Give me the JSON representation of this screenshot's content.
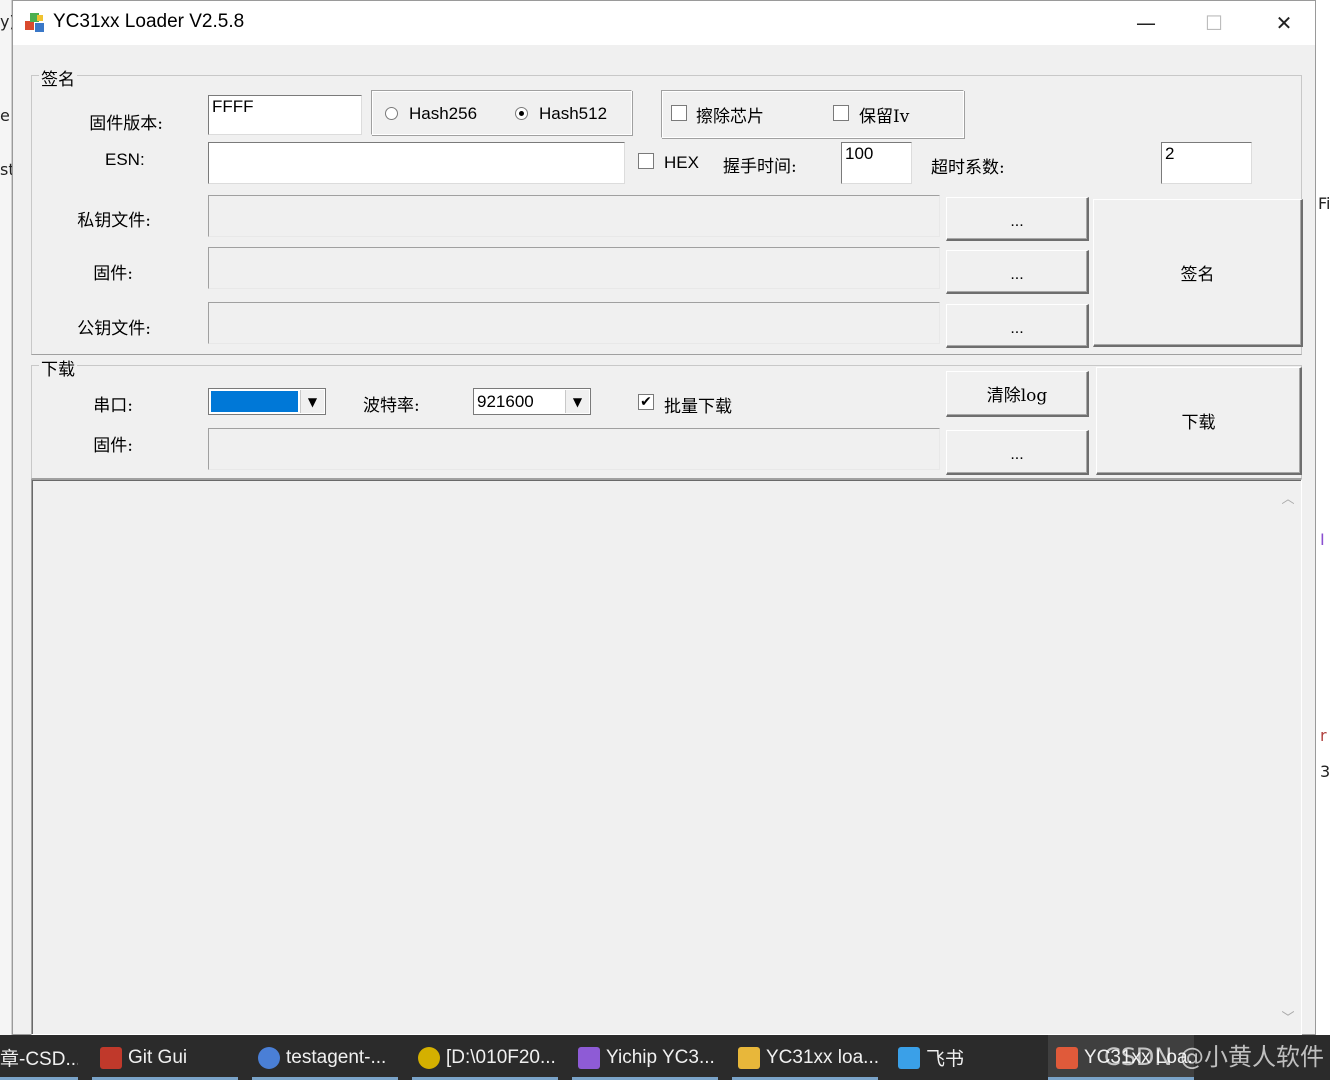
{
  "background": {
    "left_fragments": [
      "y)",
      "e",
      "st"
    ],
    "right_fragments": [
      "Fi",
      "I",
      "r",
      "3"
    ]
  },
  "window": {
    "title": "YC31xx Loader V2.5.8",
    "icon": "app-cubes-icon",
    "controls": {
      "minimize": "—",
      "maximize": "☐",
      "close": "✕"
    }
  },
  "sign_group": {
    "label": "签名",
    "firmware_version_label": "固件版本:",
    "firmware_version_value": "FFFF",
    "hash_options": [
      {
        "label": "Hash256",
        "selected": false
      },
      {
        "label": "Hash512",
        "selected": true
      }
    ],
    "erase_chip": {
      "label": "擦除芯片",
      "checked": false
    },
    "keep_iv": {
      "label": "保留Iv",
      "checked": false
    },
    "esn_label": "ESN:",
    "esn_value": "",
    "hex": {
      "label": "HEX",
      "checked": false
    },
    "handshake_label": "握手时间:",
    "handshake_value": "100",
    "timeout_label": "超时系数:",
    "timeout_value": "2",
    "private_key_label": "私钥文件:",
    "firmware_label": "固件:",
    "public_key_label": "公钥文件:",
    "browse_label": "...",
    "sign_button": "签名"
  },
  "download_group": {
    "label": "下载",
    "port_label": "串口:",
    "port_value": "",
    "baud_label": "波特率:",
    "baud_value": "921600",
    "batch": {
      "label": "批量下载",
      "checked": true
    },
    "clear_log_button": "清除log",
    "firmware_label": "固件:",
    "browse_label": "...",
    "download_button": "下载"
  },
  "log": {
    "scroll_up": "︿",
    "scroll_down": "﹀"
  },
  "taskbar": {
    "items": [
      {
        "label": "章-CSD...",
        "icon": "browser-icon",
        "color": "#c0392b",
        "active": false
      },
      {
        "label": "Git Gui",
        "icon": "git-gui-icon",
        "color": "#e74c3c",
        "active": false
      },
      {
        "label": "testagent-...",
        "icon": "agent-icon",
        "color": "#4a7fd6",
        "active": false
      },
      {
        "label": "[D:\\010F20...",
        "icon": "terminal-app-icon",
        "color": "#d4b000",
        "active": false
      },
      {
        "label": "Yichip YC3...",
        "icon": "visual-studio-icon",
        "color": "#8e5bd6",
        "active": false
      },
      {
        "label": "YC31xx loa...",
        "icon": "folder-icon",
        "color": "#e8b73a",
        "active": false
      },
      {
        "label": "飞书",
        "icon": "feishu-icon",
        "color": "#3aa0e8",
        "active": false
      },
      {
        "label": "YC31xx Loa...",
        "icon": "app-cubes-icon",
        "color": "#e05a3a",
        "active": true
      }
    ],
    "watermark": "CSDN @小黄人软件"
  },
  "colors": {
    "window_bg": "#f0f0f0",
    "port_selected": "#0078d7",
    "taskbar_bg": "#2b2b2b"
  }
}
